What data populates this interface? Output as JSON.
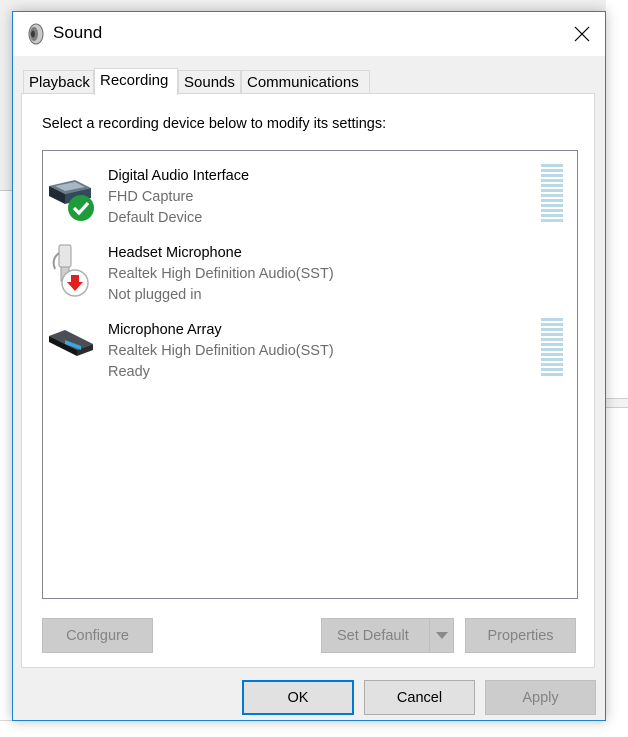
{
  "window": {
    "title": "Sound"
  },
  "tabs": [
    {
      "label": "Playback",
      "active": false
    },
    {
      "label": "Recording",
      "active": true
    },
    {
      "label": "Sounds",
      "active": false
    },
    {
      "label": "Communications",
      "active": false
    }
  ],
  "recording": {
    "instruction": "Select a recording device below to modify its settings:",
    "devices": [
      {
        "name": "Digital Audio Interface",
        "description": "FHD Capture",
        "status": "Default Device",
        "icon": "capture-device-icon",
        "badge": "default-check-icon",
        "level_meter": true
      },
      {
        "name": "Headset Microphone",
        "description": "Realtek High Definition Audio(SST)",
        "status": "Not plugged in",
        "icon": "headset-microphone-icon",
        "badge": "unplugged-arrow-icon",
        "level_meter": false
      },
      {
        "name": "Microphone Array",
        "description": "Realtek High Definition Audio(SST)",
        "status": "Ready",
        "icon": "microphone-array-icon",
        "badge": null,
        "level_meter": true
      }
    ],
    "buttons": {
      "configure": "Configure",
      "set_default": "Set Default",
      "properties": "Properties"
    }
  },
  "dialog_buttons": {
    "ok": "OK",
    "cancel": "Cancel",
    "apply": "Apply"
  },
  "colors": {
    "accent": "#0078d7",
    "window_border": "#1883d7",
    "check_green": "#1e9c3c",
    "unplugged_red": "#e01f1f",
    "level_meter": "#b9d9e9"
  }
}
